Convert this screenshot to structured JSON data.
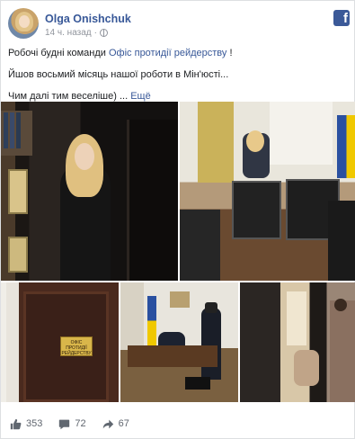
{
  "post": {
    "author": "Olga Onishchuk",
    "timestamp": "14 ч. назад",
    "line1_text": "Робочі будні команди ",
    "line1_link": "Офіс протидії рейдерству",
    "line1_end": " !",
    "line2": "Йшов восьмий місяць нашої роботи в Мін'юсті...",
    "line3_text": "Чим далі тим веселіше) ... ",
    "more_link": "Ещё",
    "door_sign": "ОФІС ПРОТИДІЇ РЕЙДЕРСТВУ"
  },
  "stats": {
    "likes": "353",
    "comments": "72",
    "shares": "67"
  },
  "colors": {
    "link": "#385898",
    "brand": "#3b5998",
    "muted": "#90949c"
  }
}
